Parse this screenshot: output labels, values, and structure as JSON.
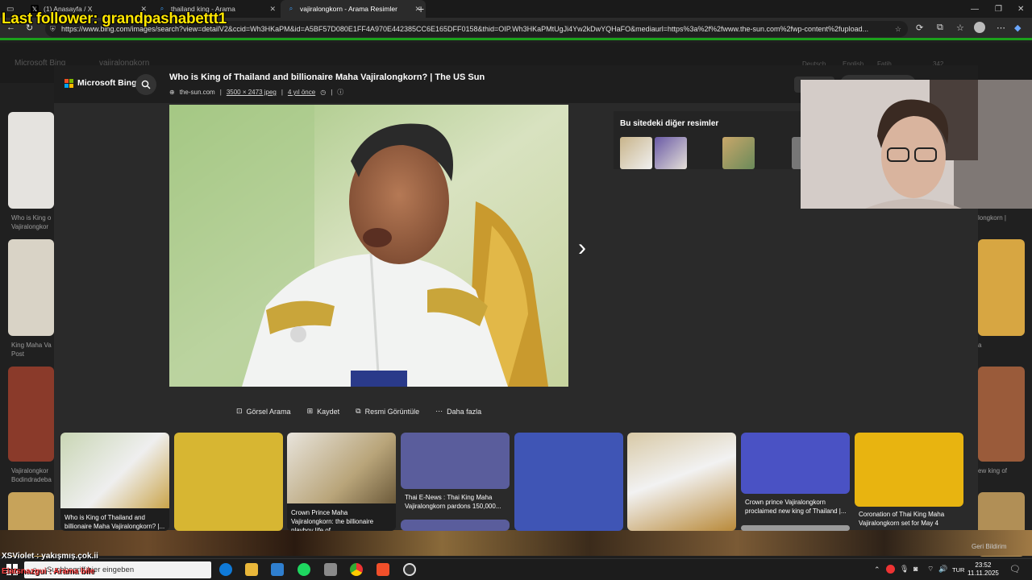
{
  "stream_overlay": {
    "last_follower": "Last follower: grandpashabettt1",
    "chat_line1": "XSViolet : yakışmış.çok.ii",
    "chat_line2": "Elatsnazgui : Arama bile"
  },
  "browser": {
    "tabs": [
      {
        "label": "(1) Anasayfa / X",
        "icon": "x-logo-icon"
      },
      {
        "label": "thailand king - Arama",
        "icon": "search-icon"
      },
      {
        "label": "vajiralongkorn - Arama Resimler",
        "icon": "search-icon",
        "active": true
      }
    ],
    "new_tab": "+",
    "address": "https://www.bing.com/images/search?view=detailV2&ccid=Wh3HKaPM&id=A5BF57D080E1FF4A970E442385CC6E165DFF0158&thid=OIP.Wh3HKaPMtUgJi4Yw2kDwYQHaFO&mediaurl=https%3a%2f%2fwww.the-sun.com%2fwp-content%2fupload..."
  },
  "bg_page": {
    "logo": "Microsoft Bing",
    "query": "vajiralongkorn",
    "lang_de": "Deutsch",
    "lang_en": "English",
    "user": "Fatih",
    "points": "342",
    "captions_left": [
      "Who is King o",
      "Vajiralongkor",
      "King Maha Va",
      "Post",
      "Vajiralongkor",
      "Bodindradeba"
    ],
    "captions_right": [
      "longkorn |",
      "a",
      "ew king of"
    ]
  },
  "modal": {
    "logo": "Microsoft Bing",
    "title": "Who is King of Thailand and billionaire Maha Vajiralongkorn? | The US Sun",
    "source": "the-sun.com",
    "dimensions": "3500 × 2473 jpeg",
    "age": "4 yıl önce",
    "side_title": "Bu sitedeki diğer resimler",
    "actions": [
      {
        "label": "Görsel Arama",
        "icon": "visual-search-icon"
      },
      {
        "label": "Kaydet",
        "icon": "save-icon"
      },
      {
        "label": "Resmi Görüntüle",
        "icon": "view-image-icon"
      },
      {
        "label": "Daha fazla",
        "icon": "more-icon"
      }
    ],
    "related": [
      {
        "caption": "Who is King of Thailand and billionaire Maha Vajiralongkorn? |...",
        "color": "#c9d6b4"
      },
      {
        "caption": "",
        "color": "#d7b632"
      },
      {
        "caption": "Crown Prince Maha Vajiralongkorn: the billionaire playboy life of ...",
        "color": "#b9a57a"
      },
      {
        "caption": "Thai E-News : Thai King Maha Vajiralongkorn pardons 150,000...",
        "color": "#5a5d9c"
      },
      {
        "caption": "",
        "color": "#3f55b5"
      },
      {
        "caption": "",
        "color": "#d8c9a6"
      },
      {
        "caption": "Crown prince Vajiralongkorn proclaimed new king of Thailand |...",
        "color": "#4a52c4"
      },
      {
        "caption": "Coronation of Thai King Maha Vajiralongkorn set for May 4",
        "color": "#e8b410"
      }
    ]
  },
  "notification": "Geri Bildirim",
  "taskbar": {
    "search_placeholder": "Suchbegriff hier eingeben",
    "lang": "TUR",
    "time": "23:52",
    "date": "11.11.2025"
  }
}
